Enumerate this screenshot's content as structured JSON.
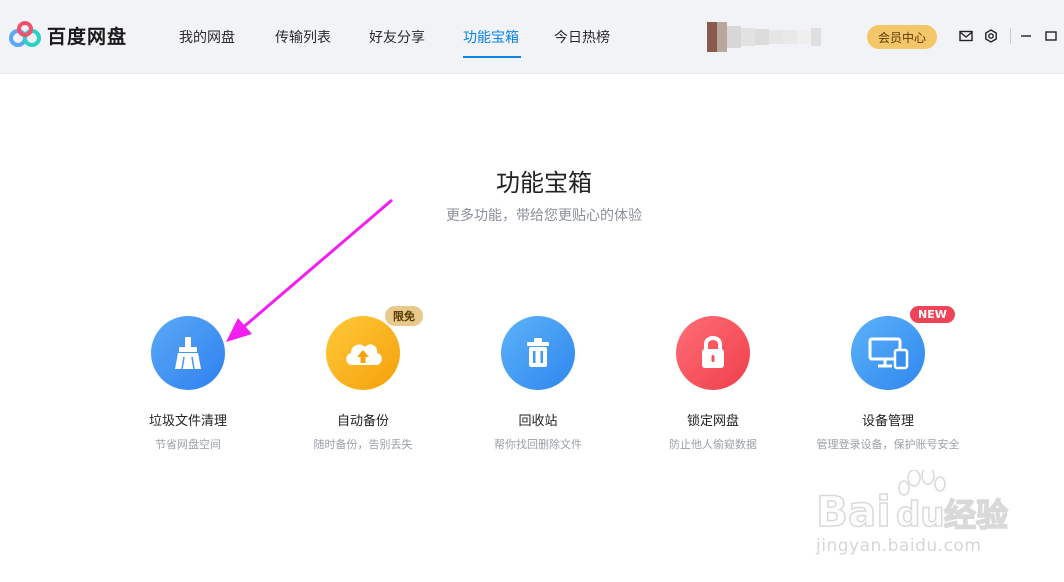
{
  "app": {
    "logo_text": "百度网盘"
  },
  "nav": {
    "items": [
      {
        "label": "我的网盘"
      },
      {
        "label": "传输列表"
      },
      {
        "label": "好友分享"
      },
      {
        "label": "功能宝箱"
      },
      {
        "label": "今日热榜"
      }
    ],
    "active_index": 3
  },
  "header": {
    "vip_label": "会员中心",
    "icons": [
      "mail-icon",
      "settings-icon",
      "minimize-icon",
      "maximize-icon"
    ]
  },
  "main": {
    "title": "功能宝箱",
    "subtitle": "更多功能，带给您更贴心的体验",
    "tools": [
      {
        "label": "垃圾文件清理",
        "desc": "节省网盘空间",
        "icon": "broom-icon",
        "color": "#3b8ff3",
        "badge": ""
      },
      {
        "label": "自动备份",
        "desc": "随时备份，告别丢失",
        "icon": "cloud-upload-icon",
        "color": "#fbb10f",
        "badge": "限免"
      },
      {
        "label": "回收站",
        "desc": "帮你找回删除文件",
        "icon": "trash-icon",
        "color": "#3f9cf5",
        "badge": ""
      },
      {
        "label": "锁定网盘",
        "desc": "防止他人偷窥数据",
        "icon": "lock-icon",
        "color": "#f5545f",
        "badge": ""
      },
      {
        "label": "设备管理",
        "desc": "管理登录设备，保护账号安全",
        "icon": "devices-icon",
        "color": "#3f9cf5",
        "badge": "NEW"
      }
    ]
  },
  "watermark": {
    "text": "jingyan.baidu.com"
  }
}
